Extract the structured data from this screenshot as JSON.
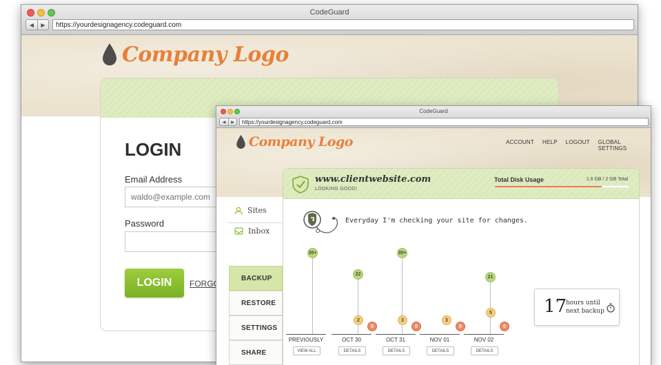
{
  "back_window": {
    "title": "CodeGuard",
    "url": "https://yourdesignagency.codeguard.com",
    "logo_text": "Company Logo",
    "login": {
      "heading": "LOGIN",
      "email_label": "Email Address",
      "email_placeholder": "waldo@example.com",
      "password_label": "Password",
      "button_label": "LOGIN",
      "forgot_label": "FORGO"
    }
  },
  "front_window": {
    "title": "CodeGuard",
    "url": "https://yourdesignagency.codeguard.com",
    "logo_text": "Company Logo",
    "nav": [
      "ACCOUNT",
      "HELP",
      "LOGOUT",
      "GLOBAL SETTINGS"
    ],
    "site": {
      "name": "www.clientwebsite.com",
      "status": "LOOKING GOOD!"
    },
    "disk": {
      "label": "Total Disk Usage",
      "value": "1.6 GB / 2 GB Total",
      "fraction": 0.8
    },
    "sidebar": [
      {
        "label": "Sites",
        "icon": "user-icon"
      },
      {
        "label": "Inbox",
        "icon": "inbox-icon"
      }
    ],
    "tabs": [
      "BACKUP",
      "RESTORE",
      "SETTINGS",
      "SHARE"
    ],
    "message": "Everyday I'm checking your site for changes.",
    "timeline": [
      {
        "label": "PREVIOUSLY",
        "button": "VIEW ALL",
        "green": "30+",
        "yellow": "",
        "red": ""
      },
      {
        "label": "OCT 30",
        "button": "DETAILS",
        "green": "22",
        "yellow": "2",
        "red": "0"
      },
      {
        "label": "OCT 31",
        "button": "DETAILS",
        "green": "30+",
        "yellow": "3",
        "red": "0"
      },
      {
        "label": "NOV 01",
        "button": "DETAILS",
        "green": "",
        "yellow": "3",
        "red": "0"
      },
      {
        "label": "NOV 02",
        "button": "DETAILS",
        "green": "21",
        "yellow": "5",
        "red": "0"
      }
    ],
    "next_backup": {
      "number": "17",
      "text_line1": "hours until",
      "text_line2": "next backup"
    }
  },
  "colors": {
    "accent_orange": "#e8803a",
    "accent_green": "#8bbf2f"
  }
}
